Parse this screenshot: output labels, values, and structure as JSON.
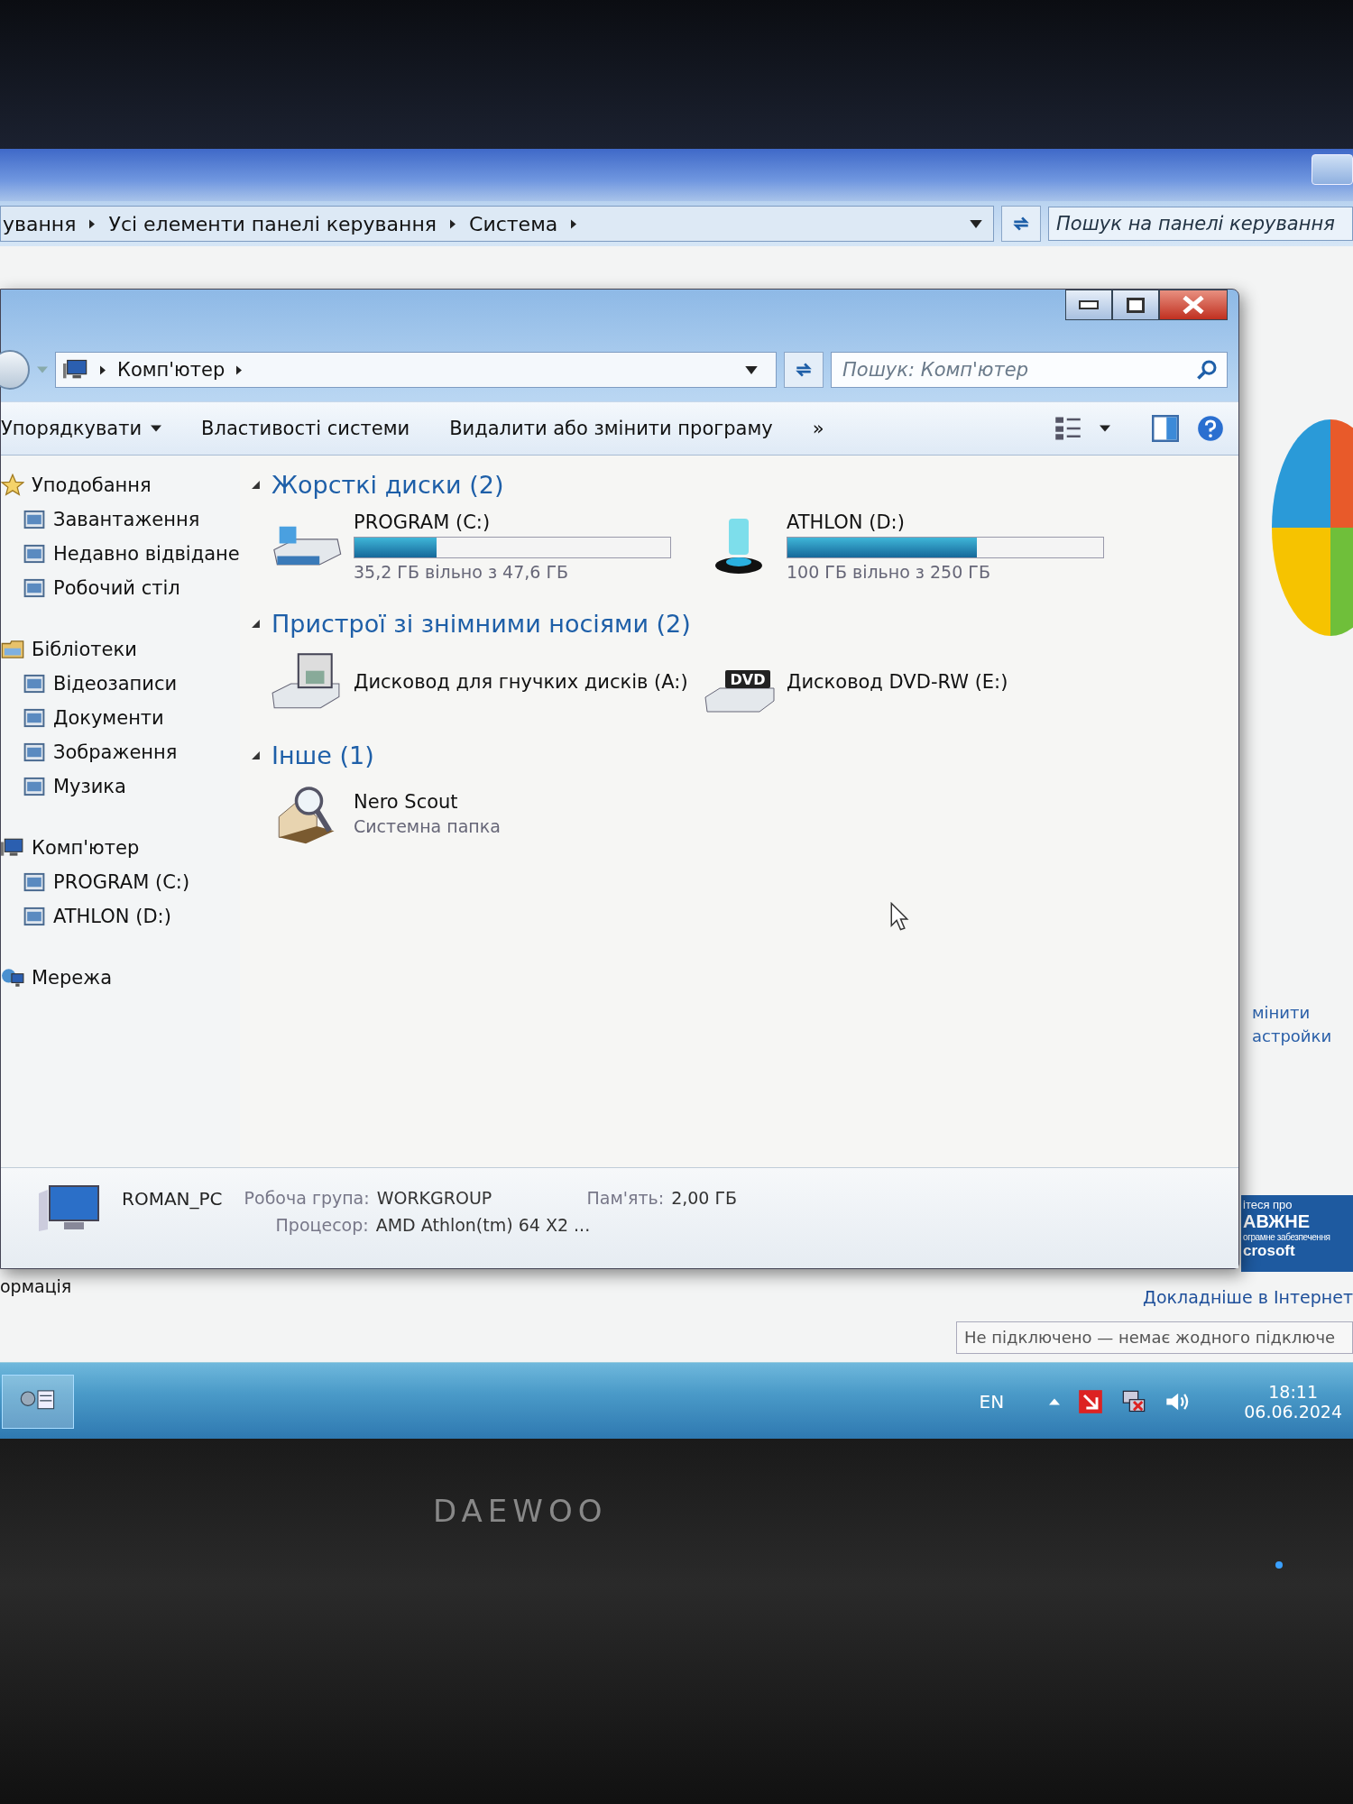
{
  "back_window": {
    "breadcrumb": [
      "ування",
      "Усі елементи панелі керування",
      "Система"
    ],
    "search": {
      "placeholder": "Пошук на панелі керування"
    },
    "side_links": [
      "мінити",
      "астройки"
    ],
    "promo": [
      "ітеся про",
      "АВЖНЕ",
      "ограмне забезпечення",
      "crosoft"
    ],
    "left_link": "ормація",
    "right_link": "Докладніше в Інтернет",
    "status": "Не підключено — немає жодного підключе"
  },
  "window": {
    "breadcrumb": [
      "Комп'ютер"
    ],
    "search": {
      "placeholder": "Пошук: Комп'ютер"
    },
    "toolbar": [
      {
        "label": "Упорядкувати",
        "menu": true
      },
      {
        "label": "Властивості системи",
        "menu": false
      },
      {
        "label": "Видалити або змінити програму",
        "menu": false
      }
    ],
    "overflow": "»",
    "sidebar": [
      {
        "label": "Уподобання",
        "children": [
          "Завантаження",
          "Недавно відвідане",
          "Робочий стіл"
        ]
      },
      {
        "label": "Бібліотеки",
        "children": [
          "Відеозаписи",
          "Документи",
          "Зображення",
          "Музика"
        ]
      },
      {
        "label": "Комп'ютер",
        "children": [
          "PROGRAM (C:)",
          "ATHLON (D:)"
        ]
      },
      {
        "label": "Мережа"
      }
    ],
    "sections": [
      {
        "title": "Жорсткі диски (2)",
        "items": [
          {
            "kind": "drive",
            "name": "PROGRAM (C:)",
            "level": 0.26,
            "free": "35,2 ГБ вільно з 47,6 ГБ"
          },
          {
            "kind": "drive",
            "name": "ATHLON (D:)",
            "level": 0.6,
            "free": "100 ГБ вільно з 250 ГБ"
          }
        ]
      },
      {
        "title": "Пристрої зі знімними носіями (2)",
        "items": [
          {
            "kind": "floppy",
            "name": "Дисковод для гнучких дисків (A:)"
          },
          {
            "kind": "dvd",
            "name": "Дисковод DVD-RW (E:)",
            "badge": "DVD"
          }
        ]
      },
      {
        "title": "Інше (1)",
        "items": [
          {
            "kind": "folder",
            "name": "Nero Scout",
            "subtitle": "Системна папка"
          }
        ]
      }
    ],
    "details": {
      "name": "ROMAN_PC",
      "fields": [
        {
          "label": "Робоча група:",
          "value": "WORKGROUP"
        },
        {
          "label": "Пам'ять:",
          "value": "2,00 ГБ"
        },
        {
          "label": "Процесор:",
          "value": "AMD Athlon(tm) 64 X2 ..."
        }
      ]
    }
  },
  "taskbar": {
    "language": "EN",
    "time": "18:11",
    "date": "06.06.2024"
  },
  "bezel": {
    "logo": "DAEWOO"
  }
}
